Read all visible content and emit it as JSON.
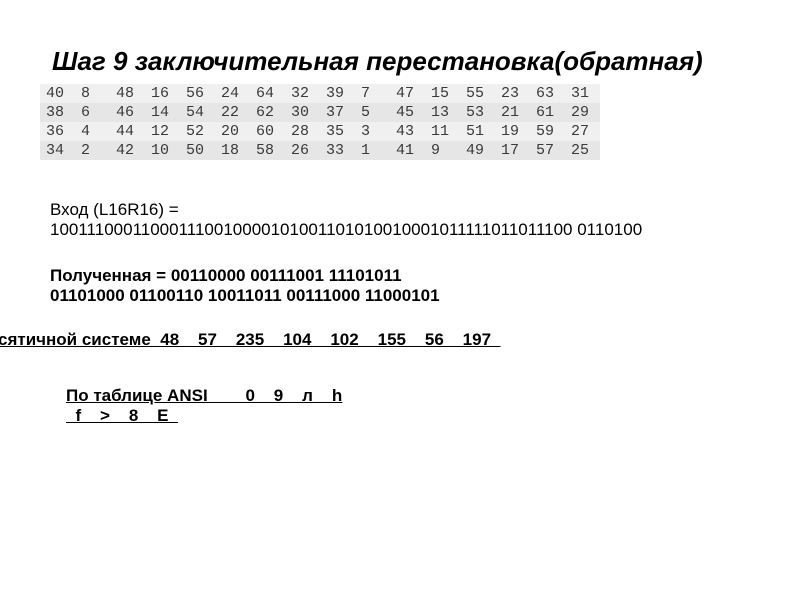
{
  "heading": "Шаг 9 заключительная перестановка(обратная)",
  "perm_table": [
    [
      40,
      8,
      48,
      16,
      56,
      24,
      64,
      32,
      39,
      7,
      47,
      15,
      55,
      23,
      63,
      31
    ],
    [
      38,
      6,
      46,
      14,
      54,
      22,
      62,
      30,
      37,
      5,
      45,
      13,
      53,
      21,
      61,
      29
    ],
    [
      36,
      4,
      44,
      12,
      52,
      20,
      60,
      28,
      35,
      3,
      43,
      11,
      51,
      19,
      59,
      27
    ],
    [
      34,
      2,
      42,
      10,
      50,
      18,
      58,
      26,
      33,
      1,
      41,
      9,
      49,
      17,
      57,
      25
    ]
  ],
  "input_label": "Вход (L16R16) =",
  "input_bits": "100111000110001110010000101001101010010001011111011011100 0110100",
  "received_line1": "Полученная =  00110000 00111001 11101011",
  "received_line2": "01101000 01100110 10011011 00111000 11000101",
  "dec_label_prefix": "сятичной системе",
  "dec_values": [
    48,
    57,
    235,
    104,
    102,
    155,
    56,
    197
  ],
  "ansi_label": "По таблице ANSI",
  "ansi_line1": [
    "0",
    "9",
    "л",
    "h"
  ],
  "ansi_line2": [
    "f",
    ">",
    "8",
    "E"
  ]
}
